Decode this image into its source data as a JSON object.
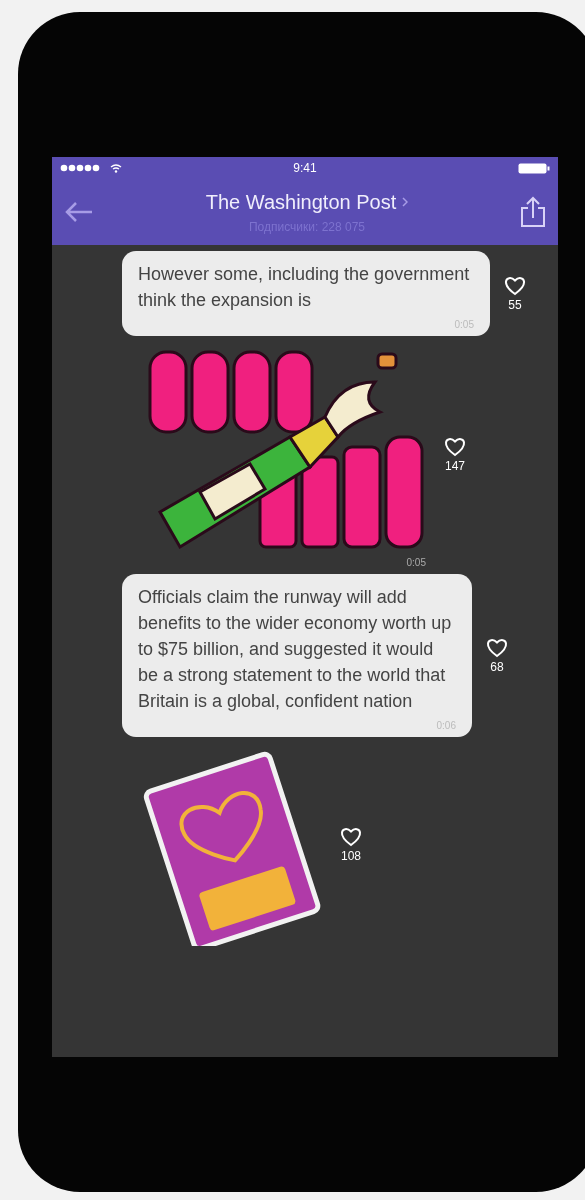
{
  "status_bar": {
    "time": "9:41"
  },
  "header": {
    "title": "The Washington Post",
    "subtitle": "Подписчики: 228 075"
  },
  "messages": [
    {
      "kind": "text",
      "text": "However some, including the government think the expansion is",
      "time": "0:05",
      "likes": "55"
    },
    {
      "kind": "champagne_sticker",
      "time": "0:05",
      "likes": "147"
    },
    {
      "kind": "text",
      "text": "Officials claim the runway will add benefits to the wider economy worth up to $75 billion, and suggested it would be a strong statement to the world that Britain is a global, confident nation",
      "time": "0:06",
      "likes": "68"
    },
    {
      "kind": "passport_sticker",
      "likes": "108"
    }
  ]
}
